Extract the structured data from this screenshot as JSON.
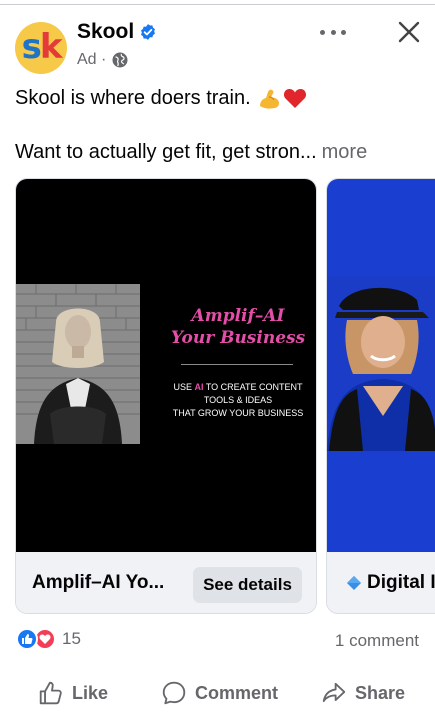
{
  "post": {
    "page_name": "Skool",
    "sub_label": "Ad ·",
    "text_line1": "Skool is where doers train.",
    "text_line2": "Want to actually get fit, get stron...",
    "see_more": "more"
  },
  "avatar": {
    "letter1": "s",
    "letter2": "k"
  },
  "carousel": [
    {
      "title": "Amplif–AI Yo...",
      "cta": "See details",
      "image": {
        "headline_line1": "Amplif–AI",
        "headline_line2": "Your Business",
        "body_pre": "USE ",
        "body_highlight": "AI",
        "body_post": " TO CREATE CONTENT",
        "body_line2": "TOOLS & IDEAS",
        "body_line3": "THAT GROW YOUR BUSINESS"
      }
    },
    {
      "title": "Digital I"
    }
  ],
  "engagement": {
    "reaction_count": "15",
    "comment_count": "1 comment"
  },
  "actions": {
    "like": "Like",
    "comment": "Comment",
    "share": "Share"
  },
  "icons": [
    "verified-icon",
    "globe-icon",
    "more-icon",
    "close-icon",
    "muscle-emoji-icon",
    "heart-emoji-icon",
    "diamond-icon",
    "like-reaction-icon",
    "love-reaction-icon",
    "like-icon",
    "comment-icon",
    "share-icon"
  ],
  "colors": {
    "accent_blue": "#1877f2",
    "brand_pink": "#e34ea8",
    "love_red": "#f33e58",
    "secondary_text": "#65676b"
  }
}
